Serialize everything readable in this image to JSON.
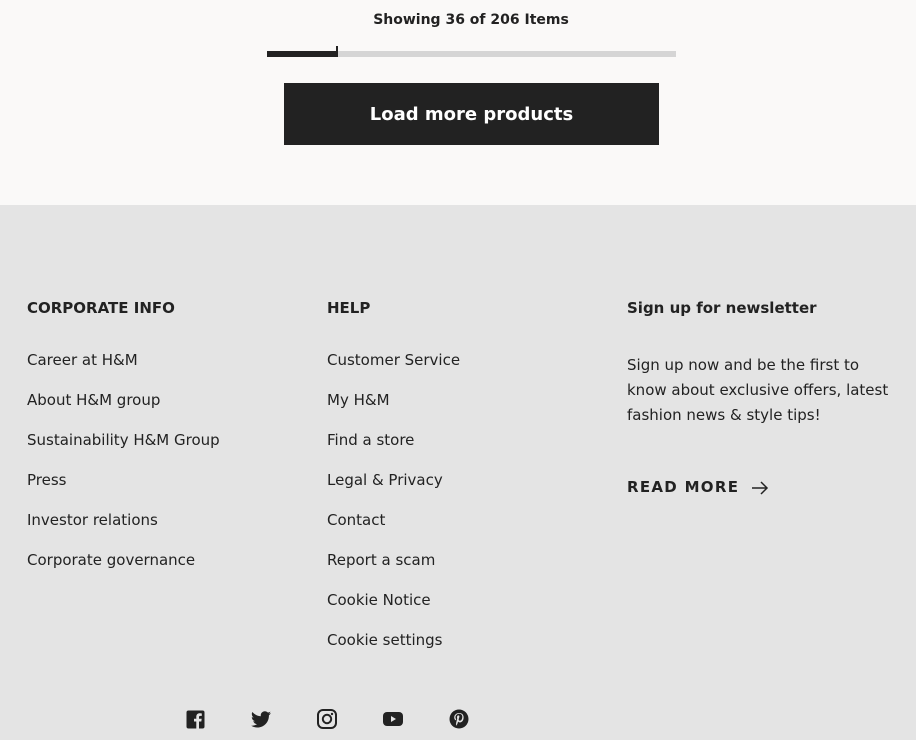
{
  "pagination": {
    "showing_text": "Showing 36 of 206 Items",
    "shown": 36,
    "total": 206,
    "load_more_label": "Load more products"
  },
  "footer": {
    "corporate": {
      "heading": "CORPORATE INFO",
      "links": [
        "Career at H&M",
        "About H&M group",
        "Sustainability H&M Group",
        "Press",
        "Investor relations",
        "Corporate governance"
      ]
    },
    "help": {
      "heading": "HELP",
      "links": [
        "Customer Service",
        "My H&M",
        "Find a store",
        "Legal & Privacy",
        "Contact",
        "Report a scam",
        "Cookie Notice",
        "Cookie settings"
      ]
    },
    "newsletter": {
      "heading": "Sign up for newsletter",
      "text": "Sign up now and be the first to know about exclusive offers, latest fashion news & style tips!",
      "read_more_label": "READ MORE",
      "arrow_icon": "arrow-right-icon"
    },
    "socials": [
      {
        "name": "facebook-icon"
      },
      {
        "name": "twitter-icon"
      },
      {
        "name": "instagram-icon"
      },
      {
        "name": "youtube-icon"
      },
      {
        "name": "pinterest-icon"
      }
    ]
  },
  "colors": {
    "top_bg": "#faf9f8",
    "footer_bg": "#e4e4e4",
    "button_bg": "#222222",
    "text": "#222222",
    "progress_track": "#d5d5d5"
  }
}
